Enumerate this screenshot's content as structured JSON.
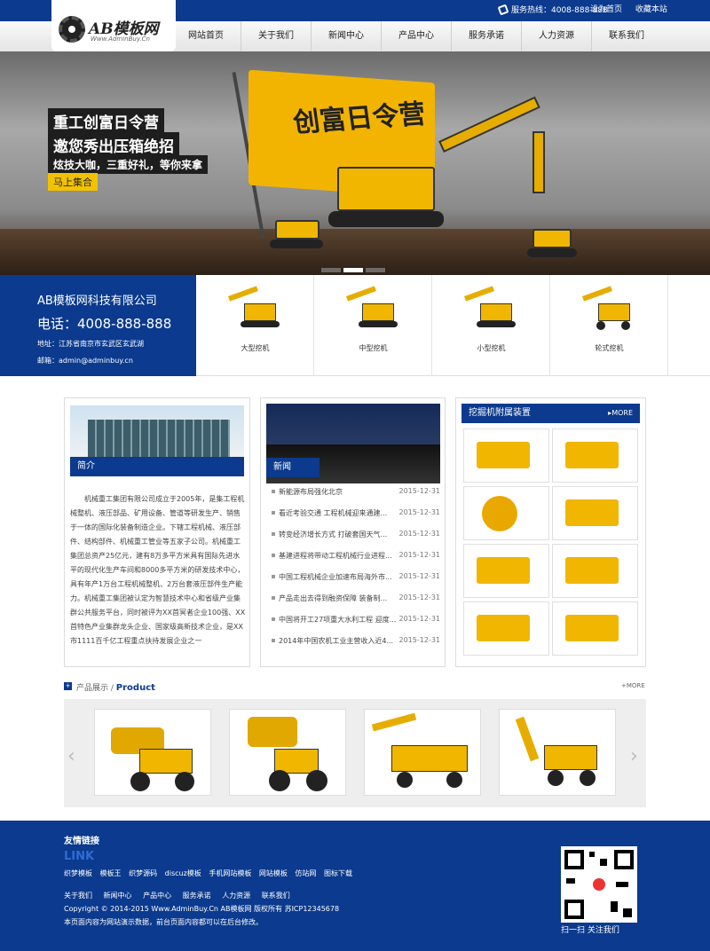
{
  "header": {
    "hotline": "服务热线：4008-888-888",
    "set_home": "设为首页",
    "bookmark": "收藏本站",
    "logo_text": "AB模板网",
    "logo_sub": "Www.AdminBuy.Cn"
  },
  "nav": [
    "网站首页",
    "关于我们",
    "新闻中心",
    "产品中心",
    "服务承诺",
    "人力资源",
    "联系我们"
  ],
  "banner": {
    "line1": "重工创富日令营",
    "line2": "邀您秀出压箱绝招",
    "line3": "炫技大咖，三重好礼，等你来拿",
    "button": "马上集合",
    "flag_text": "创富日令营"
  },
  "company": {
    "name": "AB模板网科技有限公司",
    "phone": "电话：4008-888-888",
    "address": "地址：江苏省南京市玄武区玄武湖",
    "email": "邮箱：admin@adminbuy.cn"
  },
  "categories": [
    "大型挖机",
    "中型挖机",
    "小型挖机",
    "轮式挖机"
  ],
  "intro": {
    "title": "简介",
    "text": "机械重工集团有限公司成立于2005年，是集工程机械整机、液压部品、矿用设备、管道等研发生产、销售于一体的国际化装备制造企业。下辖工程机械、液压部件、结构部件、机械重工管业等五家子公司。机械重工集团总资产25亿元，建有8万多平方米具有国际先进水平的现代化生产车间和8000多平方米的研发技术中心，具有年产1万台工程机械整机、2万台套液压部件生产能力。机械重工集团被认定为智慧技术中心和省级产业集群公共服务平台，同时被评为XX首冥者企业100强、XX首特色产业集群龙头企业、国家级高新技术企业，是XX市1111百千亿工程重点扶持发展企业之一"
  },
  "news": {
    "title": "新闻",
    "items": [
      {
        "title": "新能源布局强化北京",
        "date": "2015-12-31"
      },
      {
        "title": "看近考验交通 工程机械迎来通建...",
        "date": "2015-12-31"
      },
      {
        "title": "转变经济增长方式 打破套国天气...",
        "date": "2015-12-31"
      },
      {
        "title": "基建进程将带动工程机械行业进程...",
        "date": "2015-12-31"
      },
      {
        "title": "中国工程机械企业加速布局海外市...",
        "date": "2015-12-31"
      },
      {
        "title": "产品走出去得到融资保障 装备制...",
        "date": "2015-12-31"
      },
      {
        "title": "中国将开工27项重大水利工程 迎度...",
        "date": "2015-12-31"
      },
      {
        "title": "2014年中国农机工业主营收入近4...",
        "date": "2015-12-31"
      }
    ]
  },
  "parts": {
    "title": "挖掘机附属装置",
    "more": "MORE"
  },
  "products": {
    "title": "产品展示",
    "subtitle": "Product",
    "more": "MORE"
  },
  "footer": {
    "friend_title": "友情链接",
    "friend_en": "LINK",
    "links": [
      "织梦模板",
      "模板王",
      "织梦源码",
      "discuz模板",
      "手机网站模板",
      "网站模板",
      "仿站网",
      "图标下载"
    ],
    "nav": [
      "关于我们",
      "新闻中心",
      "产品中心",
      "服务承诺",
      "人力资源",
      "联系我们"
    ],
    "copyright": "Copyright © 2014-2015 Www.AdminBuy.Cn AB模板网 版权所有 苏ICP12345678",
    "note": "本页面内容为网站演示数据，前台页面内容都可以在后台修改。",
    "qr_label": "扫一扫   关注我们"
  },
  "colors": {
    "primary": "#0b3a8e",
    "accent": "#f2c200"
  }
}
